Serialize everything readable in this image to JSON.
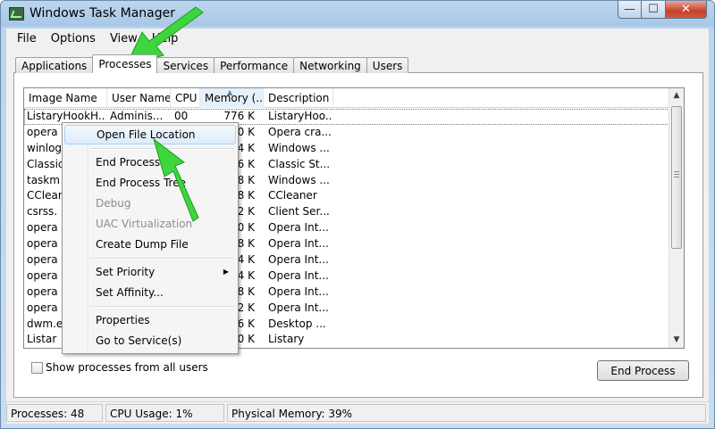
{
  "window": {
    "title": "Windows Task Manager",
    "caption": {
      "min": "—",
      "max": "☐",
      "close": "✕"
    }
  },
  "menubar": {
    "items": [
      "File",
      "Options",
      "View",
      "Help"
    ]
  },
  "tabs": [
    "Applications",
    "Processes",
    "Services",
    "Performance",
    "Networking",
    "Users"
  ],
  "active_tab": "Processes",
  "columns": [
    "Image Name",
    "User Name",
    "CPU",
    "Memory (...",
    "Description"
  ],
  "rows": [
    {
      "name": "ListaryHookH...",
      "user": "Adminis...",
      "cpu": "00",
      "mem": "776 K",
      "desc": "ListaryHoo..."
    },
    {
      "name": "opera",
      "user": "",
      "cpu": "",
      "mem": "120 K",
      "desc": "Opera cra..."
    },
    {
      "name": "winlog",
      "user": "",
      "cpu": "",
      "mem": "384 K",
      "desc": "Windows ..."
    },
    {
      "name": "Classic",
      "user": "",
      "cpu": "",
      "mem": "236 K",
      "desc": "Classic St..."
    },
    {
      "name": "taskm",
      "user": "",
      "cpu": "",
      "mem": "528 K",
      "desc": "Windows ..."
    },
    {
      "name": "CClean",
      "user": "",
      "cpu": "",
      "mem": "328 K",
      "desc": "CCleaner"
    },
    {
      "name": "csrss.",
      "user": "",
      "cpu": "",
      "mem": "472 K",
      "desc": "Client Ser..."
    },
    {
      "name": "opera",
      "user": "",
      "cpu": "",
      "mem": "040 K",
      "desc": "Opera Int..."
    },
    {
      "name": "opera",
      "user": "",
      "cpu": "",
      "mem": "168 K",
      "desc": "Opera Int..."
    },
    {
      "name": "opera",
      "user": "",
      "cpu": "",
      "mem": "424 K",
      "desc": "Opera Int..."
    },
    {
      "name": "opera",
      "user": "",
      "cpu": "",
      "mem": "464 K",
      "desc": "Opera Int..."
    },
    {
      "name": "opera",
      "user": "",
      "cpu": "",
      "mem": "348 K",
      "desc": "Opera Int..."
    },
    {
      "name": "opera",
      "user": "",
      "cpu": "",
      "mem": "772 K",
      "desc": "Opera Int..."
    },
    {
      "name": "dwm.e",
      "user": "",
      "cpu": "",
      "mem": "496 K",
      "desc": "Desktop ..."
    },
    {
      "name": "Listar",
      "user": "",
      "cpu": "",
      "mem": "080 K",
      "desc": "Listary"
    }
  ],
  "context_menu": {
    "open_file_location": "Open File Location",
    "end_process": "End Process",
    "end_process_tree": "End Process Tree",
    "debug": "Debug",
    "uac_virtualization": "UAC Virtualization",
    "create_dump_file": "Create Dump File",
    "set_priority": "Set Priority",
    "set_affinity": "Set Affinity...",
    "properties": "Properties",
    "go_to_services": "Go to Service(s)"
  },
  "show_all_label": "Show processes from all users",
  "end_process_button": "End Process",
  "status": {
    "processes": "Processes: 48",
    "cpu": "CPU Usage: 1%",
    "memory": "Physical Memory: 39%"
  },
  "colors": {
    "arrow": "#3dd63d",
    "title_gradient": "#a9c8e6",
    "close_button": "#c5412c"
  }
}
